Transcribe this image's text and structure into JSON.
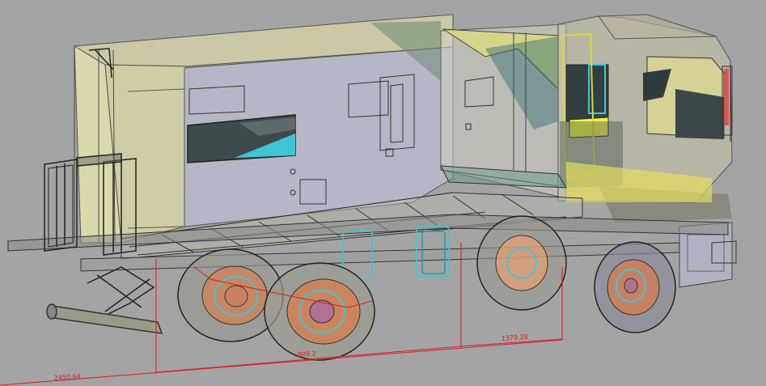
{
  "viewport": {
    "background": "#a4a4a4",
    "model": "truck-camper-cad-model"
  },
  "dimensions": {
    "overall_length": "2450.64",
    "middle_span": "909.2",
    "wheelbase_front": "1379.28"
  },
  "colors": {
    "cabin_fill": "#e9e6a6",
    "interior_wall": "#b7b8c9",
    "window_dark": "#3e4a4c",
    "accent_cyan": "#3fc6d6",
    "wheel_orange": "#e8743a",
    "dimension_red": "#d42020",
    "cab_yellow": "#f2f04a"
  }
}
